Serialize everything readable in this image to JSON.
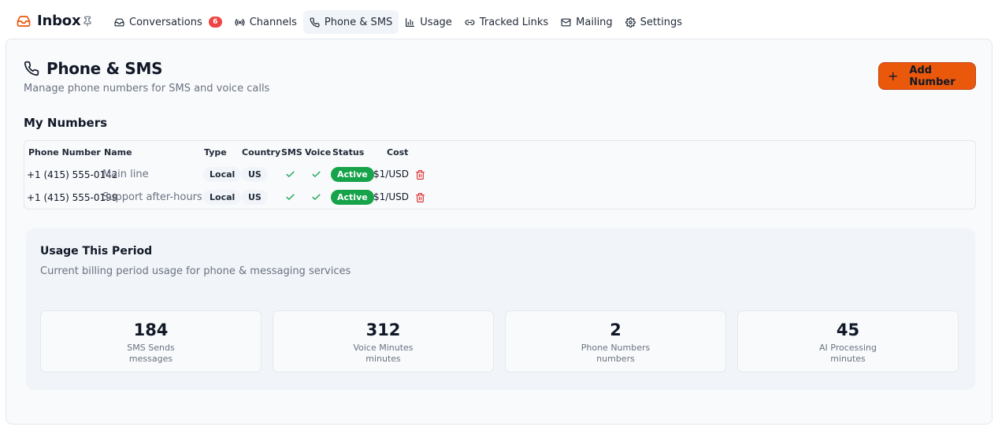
{
  "app": {
    "title": "Inbox",
    "accent": "#ea580c"
  },
  "nav": [
    {
      "label": "Conversations",
      "icon": "inbox-icon",
      "badge": "6"
    },
    {
      "label": "Channels",
      "icon": "radio-icon"
    },
    {
      "label": "Phone & SMS",
      "icon": "phone-icon",
      "active": true
    },
    {
      "label": "Usage",
      "icon": "bar-chart-icon"
    },
    {
      "label": "Tracked Links",
      "icon": "link-icon"
    },
    {
      "label": "Mailing",
      "icon": "mail-icon"
    },
    {
      "label": "Settings",
      "icon": "gear-icon"
    }
  ],
  "page": {
    "title": "Phone & SMS",
    "subtitle": "Manage phone numbers for SMS and voice calls",
    "add_button": "Add Number"
  },
  "numbers": {
    "title": "My Numbers",
    "columns": [
      "Phone Number",
      "Name",
      "Type",
      "Country",
      "SMS",
      "Voice",
      "Status",
      "Cost"
    ],
    "rows": [
      {
        "phone": "+1 (415) 555-0142",
        "name": "Main line",
        "type": "Local",
        "country": "US",
        "sms": true,
        "voice": true,
        "status": "Active",
        "cost": "$1/USD"
      },
      {
        "phone": "+1 (415) 555-0199",
        "name": "Support after-hours",
        "type": "Local",
        "country": "US",
        "sms": true,
        "voice": true,
        "status": "Active",
        "cost": "$1/USD"
      }
    ]
  },
  "usage": {
    "title": "Usage This Period",
    "subtitle": "Current billing period usage for phone & messaging services",
    "stats": [
      {
        "value": "184",
        "label": "SMS Sends",
        "unit": "messages"
      },
      {
        "value": "312",
        "label": "Voice Minutes",
        "unit": "minutes"
      },
      {
        "value": "2",
        "label": "Phone Numbers",
        "unit": "numbers"
      },
      {
        "value": "45",
        "label": "AI Processing",
        "unit": "minutes"
      }
    ]
  }
}
